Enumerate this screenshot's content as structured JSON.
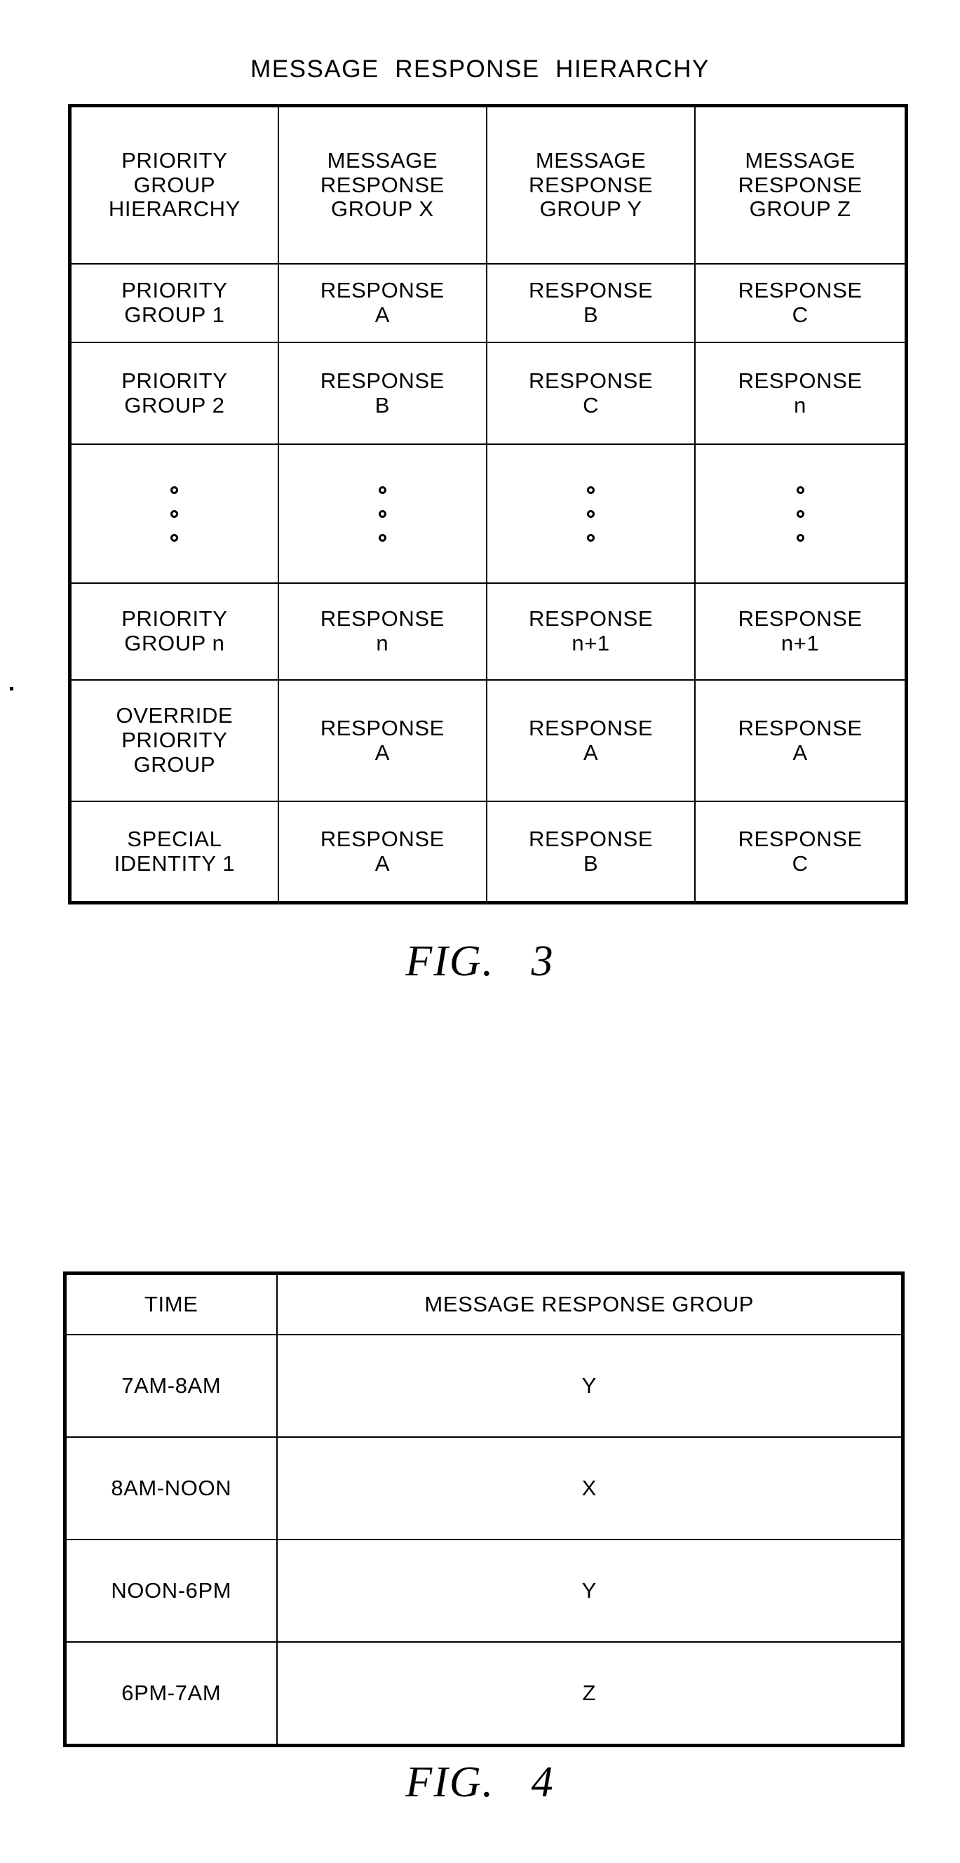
{
  "figures": [
    {
      "id": "fig3",
      "title": "MESSAGE  RESPONSE  HIERARCHY",
      "caption": "FIG.   3",
      "table": {
        "headers": [
          "PRIORITY\nGROUP\nHIERARCHY",
          "MESSAGE\nRESPONSE\nGROUP X",
          "MESSAGE\nRESPONSE\nGROUP Y",
          "MESSAGE\nRESPONSE\nGROUP Z"
        ],
        "rows": [
          {
            "kind": "text",
            "cells": [
              "PRIORITY\nGROUP 1",
              "RESPONSE\nA",
              "RESPONSE\nB",
              "RESPONSE\nC"
            ]
          },
          {
            "kind": "text",
            "cells": [
              "PRIORITY\nGROUP 2",
              "RESPONSE\nB",
              "RESPONSE\nC",
              "RESPONSE\nn"
            ]
          },
          {
            "kind": "ellipsis",
            "cells": [
              "",
              "",
              "",
              ""
            ],
            "dot_count": 3
          },
          {
            "kind": "text",
            "cells": [
              "PRIORITY\nGROUP n",
              "RESPONSE\nn",
              "RESPONSE\nn+1",
              "RESPONSE\nn+1"
            ]
          },
          {
            "kind": "text",
            "cells": [
              "OVERRIDE\nPRIORITY\nGROUP",
              "RESPONSE\nA",
              "RESPONSE\nA",
              "RESPONSE\nA"
            ]
          },
          {
            "kind": "text",
            "cells": [
              "SPECIAL\nIDENTITY 1",
              "RESPONSE\nA",
              "RESPONSE\nB",
              "RESPONSE\nC"
            ]
          }
        ]
      }
    },
    {
      "id": "fig4",
      "title": "",
      "caption": "FIG.   4",
      "table": {
        "headers": [
          "TIME",
          "MESSAGE  RESPONSE  GROUP"
        ],
        "rows": [
          {
            "kind": "text",
            "cells": [
              "7AM-8AM",
              "Y"
            ]
          },
          {
            "kind": "text",
            "cells": [
              "8AM-NOON",
              "X"
            ]
          },
          {
            "kind": "text",
            "cells": [
              "NOON-6PM",
              "Y"
            ]
          },
          {
            "kind": "text",
            "cells": [
              "6PM-7AM",
              "Z"
            ]
          }
        ]
      }
    }
  ],
  "colors": {
    "ink": "#000000",
    "paper": "#ffffff"
  }
}
